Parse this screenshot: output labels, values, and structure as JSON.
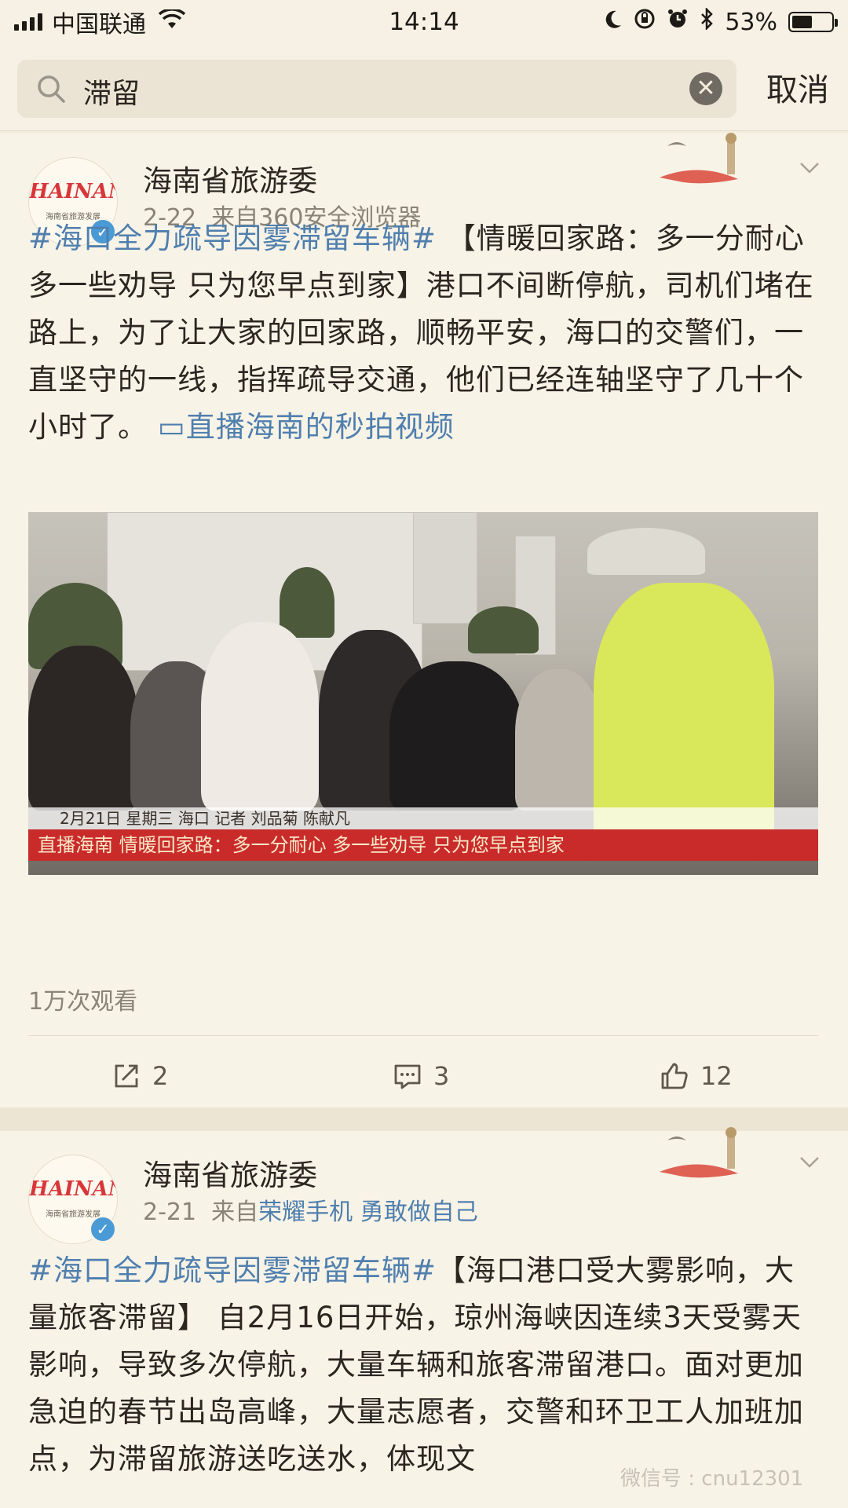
{
  "status_bar": {
    "carrier": "中国联通",
    "time": "14:14",
    "battery_percent": "53%",
    "battery_level": 0.53
  },
  "search": {
    "query": "滞留",
    "cancel_label": "取消"
  },
  "posts": [
    {
      "account": "海南省旅游委",
      "date": "2-22",
      "source_prefix": "来自",
      "source": "360安全浏览器",
      "hashtag": "#海口全力疏导因雾滞留车辆#",
      "body": "【情暖回家路：多一分耐心 多一些劝导 只为您早点到家】港口不间断停航，司机们堵在路上，为了让大家的回家路，顺畅平安，海口的交警们，一直坚守的一线，指挥疏导交通，他们已经连轴坚守了几十个小时了。",
      "video_link": "直播海南的秒拍视频",
      "video_strip": "2月21日 星期三   海口   记者 刘品菊 陈献凡",
      "video_caption": "直播海南   情暖回家路：多一分耐心 多一些劝导 只为您早点到家",
      "views": "1万次观看",
      "reposts": "2",
      "comments": "3",
      "likes": "12"
    },
    {
      "account": "海南省旅游委",
      "date": "2-21",
      "source_prefix": "来自",
      "source": "荣耀手机 勇敢做自己",
      "hashtag": "#海口全力疏导因雾滞留车辆#",
      "body": "【海口港口受大雾影响，大量旅客滞留】 自2月16日开始，琼州海峡因连续3天受雾天影响，导致多次停航，大量车辆和旅客滞留港口。面对更加急迫的春节出岛高峰，大量志愿者，交警和环卫工人加班加点，为滞留旅游送吃送水，体现文"
    }
  ],
  "avatar": {
    "logo": "HAINAN",
    "tagline": "海南省旅游发展"
  },
  "watermark": "微信号 : cnu12301",
  "colors": {
    "background": "#f3eddd",
    "link": "#4f7fae",
    "verified": "#4a9ad6",
    "caption_red": "#c92b2b"
  }
}
